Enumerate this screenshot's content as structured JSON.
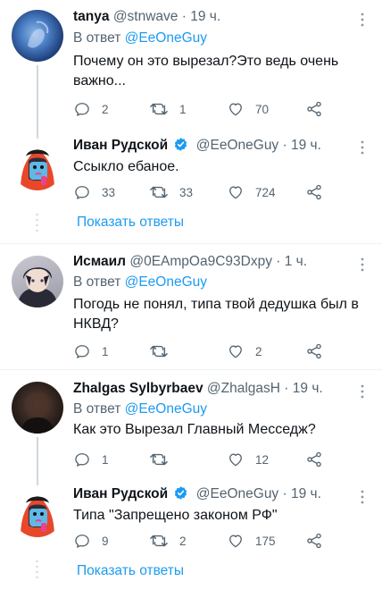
{
  "tweets": [
    {
      "name": "tanya",
      "handle": "@stnwave",
      "sep": "·",
      "time": "19 ч.",
      "reply_prefix": "В ответ",
      "reply_mention": "@EeOneGuy",
      "text": "Почему он это вырезал?Это ведь очень важно...",
      "replies": "2",
      "retweets": "1",
      "likes": "70",
      "verified": false
    },
    {
      "name": "Иван Рудской",
      "handle": "@EeOneGuy",
      "sep": "·",
      "time": "19 ч.",
      "text": "Ссыкло ебаное.",
      "replies": "33",
      "retweets": "33",
      "likes": "724",
      "verified": true
    },
    {
      "name": "Исмаил",
      "handle": "@0EAmpOa9C93Dxpy",
      "sep": "·",
      "time": "1 ч.",
      "reply_prefix": "В ответ",
      "reply_mention": "@EeOneGuy",
      "text": "Погодь не понял, типа твой дедушка был в НКВД?",
      "replies": "1",
      "retweets": "",
      "likes": "2",
      "verified": false
    },
    {
      "name": "Zhalgas Sylbyrbaev",
      "handle": "@ZhalgasH",
      "sep": "·",
      "time": "19 ч.",
      "reply_prefix": "В ответ",
      "reply_mention": "@EeOneGuy",
      "text": "Как это Вырезал Главный Месседж?",
      "replies": "1",
      "retweets": "",
      "likes": "12",
      "verified": false
    },
    {
      "name": "Иван Рудской",
      "handle": "@EeOneGuy",
      "sep": "·",
      "time": "19 ч.",
      "text": "Типа \"Запрещено законом РФ\"",
      "replies": "9",
      "retweets": "2",
      "likes": "175",
      "verified": true
    }
  ],
  "show_replies_label": "Показать ответы",
  "colors": {
    "accent": "#1d9bf0",
    "muted": "#536471",
    "thread_line": "#cfd9de"
  },
  "icons": [
    "reply-icon",
    "retweet-icon",
    "like-icon",
    "share-icon",
    "more-icon",
    "verified-badge-icon"
  ]
}
